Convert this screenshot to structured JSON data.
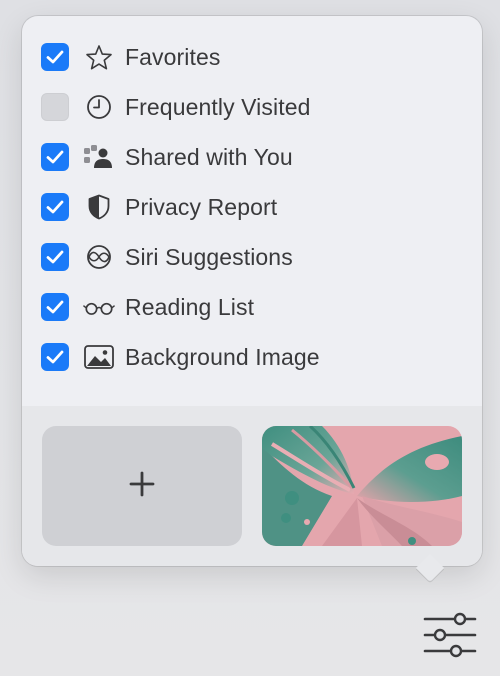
{
  "items": [
    {
      "label": "Favorites",
      "checked": true,
      "icon": "star-icon"
    },
    {
      "label": "Frequently Visited",
      "checked": false,
      "icon": "clock-icon"
    },
    {
      "label": "Shared with You",
      "checked": true,
      "icon": "shared-people-icon"
    },
    {
      "label": "Privacy Report",
      "checked": true,
      "icon": "shield-icon"
    },
    {
      "label": "Siri Suggestions",
      "checked": true,
      "icon": "siri-icon"
    },
    {
      "label": "Reading List",
      "checked": true,
      "icon": "glasses-icon"
    },
    {
      "label": "Background Image",
      "checked": true,
      "icon": "photo-icon"
    }
  ],
  "add_tile": {
    "symbol": "+"
  },
  "colors": {
    "accent": "#1a7af8",
    "text": "#3a3a3c",
    "thumb_pink": "#e6a8ae",
    "thumb_teal": "#4e9487"
  },
  "toolbar": {
    "settings_icon": "sliders-icon"
  }
}
